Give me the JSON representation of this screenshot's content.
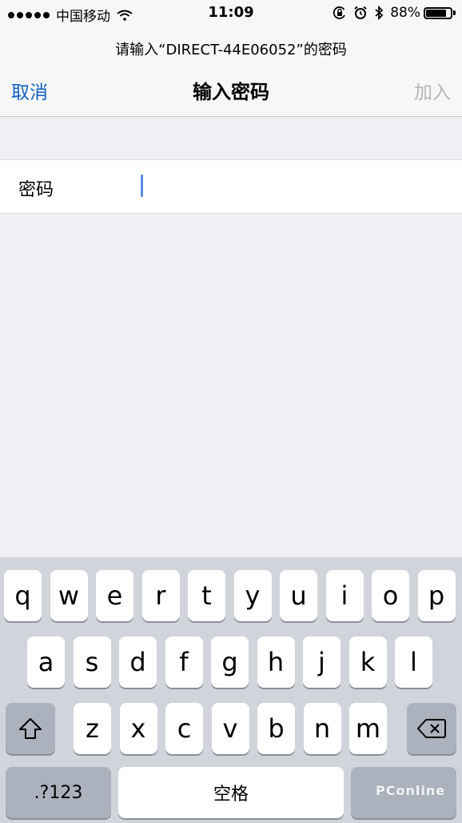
{
  "status_bar": {
    "carrier": "中国移动",
    "time": "11:09",
    "battery_text": "88%",
    "battery_level": 0.88,
    "icons": [
      "signal-dots",
      "wifi-icon",
      "orientation-lock-icon",
      "alarm-icon",
      "bluetooth-icon",
      "battery-icon"
    ]
  },
  "nav": {
    "prompt": "请输入“DIRECT-44E06052”的密码",
    "cancel": "取消",
    "title": "输入密码",
    "join": "加入"
  },
  "form": {
    "password_label": "密码",
    "password_value": ""
  },
  "keyboard": {
    "row1": [
      "q",
      "w",
      "e",
      "r",
      "t",
      "y",
      "u",
      "i",
      "o",
      "p"
    ],
    "row2": [
      "a",
      "s",
      "d",
      "f",
      "g",
      "h",
      "j",
      "k",
      "l"
    ],
    "row3": [
      "z",
      "x",
      "c",
      "v",
      "b",
      "n",
      "m"
    ],
    "numbers_key": ".?123",
    "space_key": "空格",
    "icons": [
      "shift-icon",
      "delete-icon"
    ]
  },
  "watermark": "PConline"
}
